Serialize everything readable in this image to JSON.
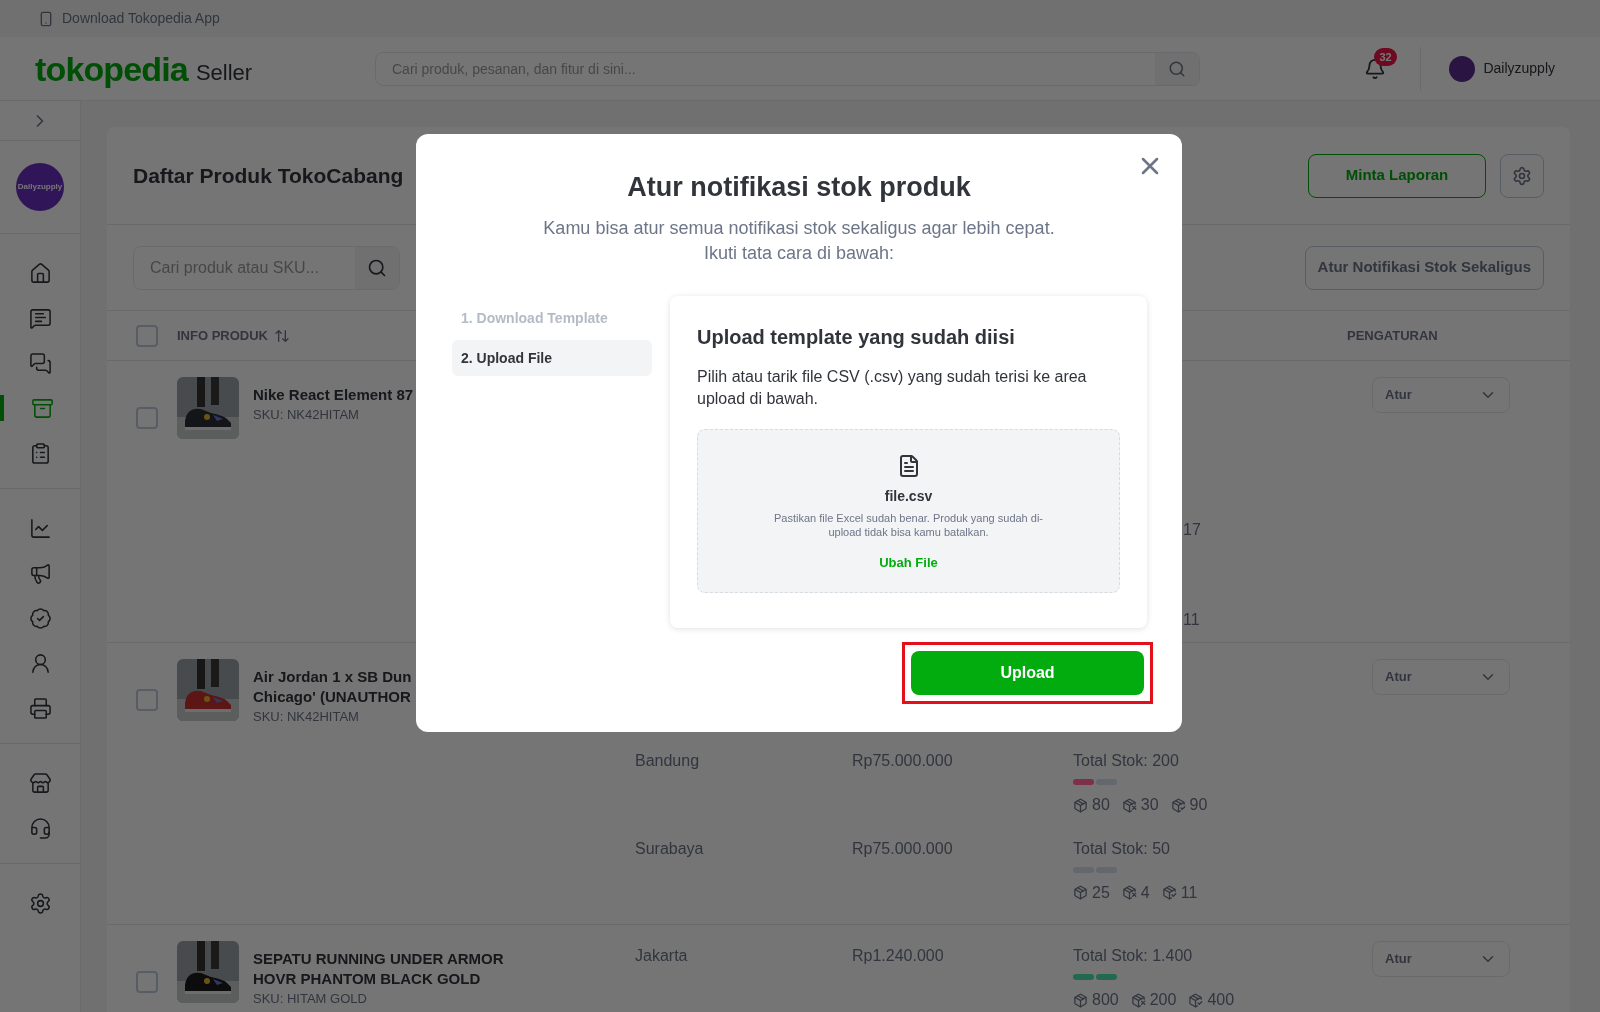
{
  "topbar": {
    "text": "Download Tokopedia App"
  },
  "header": {
    "logo": "tokopedia",
    "logo_suffix": "Seller",
    "search": {
      "placeholder": "Cari produk, pesanan, dan fitur di sini..."
    },
    "notifications": "32",
    "user": "Dailyzupply"
  },
  "sidebar": {
    "avatar": "Dailyzupply",
    "groups": [
      [
        {
          "selected": false
        },
        {
          "selected": false
        },
        {
          "selected": false
        },
        {
          "selected": true
        },
        {
          "selected": false
        }
      ],
      [
        {
          "selected": false
        },
        {
          "selected": false
        },
        {
          "selected": false
        },
        {
          "selected": false
        },
        {
          "selected": false
        }
      ],
      [
        {
          "selected": false
        },
        {
          "selected": false
        }
      ],
      [
        {
          "selected": false
        }
      ]
    ]
  },
  "page": {
    "title": "Daftar Produk TokoCabang",
    "report_button": "Minta Laporan",
    "search": {
      "placeholder": "Cari produk atau SKU..."
    },
    "bulk_button": "Atur Notifikasi Stok Sekaligus",
    "table": {
      "select_all": {
        "checked": false
      },
      "columns": [
        "INFO PRODUK",
        "PENGATURAN"
      ],
      "rows": [
        {
          "name_lines": [
            "Nike React Element 87"
          ],
          "sku": "SKU: NK42HITAM",
          "checked": false,
          "action": "Atur",
          "stock_fragments": [
            "17",
            "11"
          ],
          "locations": []
        },
        {
          "name_lines": [
            "Air Jordan 1 x SB Dun",
            "Chicago' (UNAUTHOR"
          ],
          "sku": "SKU: NK42HITAM",
          "checked": false,
          "action": "Atur",
          "stock_fragments": [],
          "locations": [
            {
              "city": "Bandung",
              "price": "Rp75.000.000",
              "total": "Total Stok: 200",
              "segments": [
                {
                  "color": "#7e3049"
                },
                {
                  "color": "#63676e"
                }
              ],
              "counts": [
                "80",
                "30",
                "90"
              ]
            },
            {
              "city": "Surabaya",
              "price": "Rp75.000.000",
              "total": "Total Stok: 50",
              "segments": [
                {
                  "color": "#63676e"
                },
                {
                  "color": "#63676e"
                }
              ],
              "counts": [
                "25",
                "4",
                "11"
              ]
            }
          ]
        },
        {
          "name_lines": [
            "SEPATU RUNNING UNDER ARMOR",
            "HOVR PHANTOM BLACK GOLD"
          ],
          "sku": "SKU: HITAM GOLD",
          "checked": false,
          "action": "Atur",
          "stock_fragments": [],
          "locations": [
            {
              "city": "Jakarta",
              "price": "Rp1.240.000",
              "total": "Total Stok: 1.400",
              "segments": [
                {
                  "color": "#22694f"
                },
                {
                  "color": "#22694f"
                }
              ],
              "counts": [
                "800",
                "200",
                "400"
              ]
            }
          ]
        }
      ]
    }
  },
  "modal": {
    "title": "Atur notifikasi stok produk",
    "subtitle_lines": [
      "Kamu bisa atur semua notifikasi stok sekaligus agar lebih cepat.",
      "Ikuti tata cara di bawah:"
    ],
    "steps": [
      {
        "label": "1. Download Template",
        "selected": false
      },
      {
        "label": "2. Upload File",
        "selected": true
      }
    ],
    "panel": {
      "title": "Upload template yang sudah diisi",
      "text": "Pilih atau tarik file CSV (.csv) yang sudah terisi ke area upload di bawah.",
      "file_name": "file.csv",
      "note": "Pastikan file Excel sudah benar. Produk yang sudah di-upload tidak bisa kamu batalkan.",
      "change_link": "Ubah File"
    },
    "submit": {
      "label": "Upload",
      "highlighted": true
    }
  }
}
